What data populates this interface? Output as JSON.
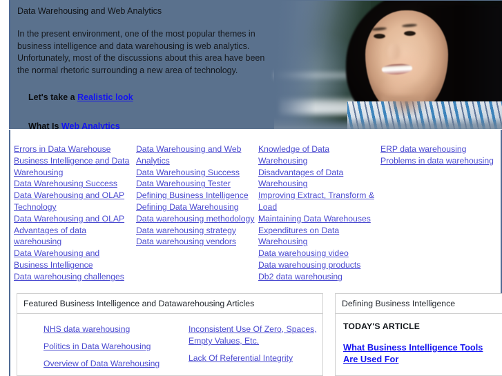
{
  "banner": {
    "title": "Data Warehousing and Web Analytics",
    "paragraph": "In the present environment, one of the most popular themes in business intelligence and data warehousing is web analytics. Unfortunately, most of the discussions about this area have been the normal rhetoric surrounding a new area of technology.",
    "cta1_prefix": "Let's take a ",
    "cta1_link": "Realistic look",
    "cta2_prefix": "What Is ",
    "cta2_link": "Web Analytics",
    "photo_alt": "smiling-woman-photo"
  },
  "link_columns": [
    {
      "name": "column-1",
      "links": [
        "Errors in Data Warehouse",
        "Business Intelligence and Data Warehousing",
        "Data Warehousing Success",
        "Data Warehousing and OLAP Technology",
        "Data Warehousing and OLAP",
        "Advantages of data warehousing",
        "Data Warehousing and Business Intelligence",
        "Data warehousing challenges"
      ]
    },
    {
      "name": "column-2",
      "links": [
        "Data Warehousing and Web Analytics",
        "Data Warehousing Success",
        "Data Warehousing Tester",
        "Defining Business Intelligence",
        "Defining Data Warehousing",
        "Data warehousing methodology",
        "Data warehousing strategy",
        "Data warehousing vendors"
      ]
    },
    {
      "name": "column-3",
      "links": [
        "Knowledge of Data Warehousing",
        "Disadvantages of Data Warehousing",
        "Improving Extract, Transform & Load",
        "Maintaining Data Warehouses",
        "Expenditures on Data Warehousing",
        "Data warehousing video",
        "Data warehousing products",
        "Db2 data warehousing"
      ]
    },
    {
      "name": "column-4",
      "links": [
        "ERP data warehousing",
        "Problems in data warehousing"
      ]
    }
  ],
  "featured_panel": {
    "heading": "Featured Business Intelligence and Datawarehousing Articles",
    "column_left": [
      "NHS data warehousing",
      "Politics in Data Warehousing",
      "Overview of Data Warehousing"
    ],
    "column_right": [
      "Inconsistent Use Of Zero, Spaces, Empty Values, Etc.",
      "Lack Of Referential Integrity"
    ]
  },
  "defining_panel": {
    "heading": "Defining Business Intelligence",
    "kicker": "TODAY'S ARTICLE",
    "article_link": "What Business Intelligence Tools Are Used For"
  },
  "colors": {
    "banner_bg": "#5a718d",
    "border_blue": "#4f6a94",
    "link_blue": "#4a4ad0",
    "strong_link_blue": "#1414f0",
    "panel_border": "#cfcfcf"
  }
}
